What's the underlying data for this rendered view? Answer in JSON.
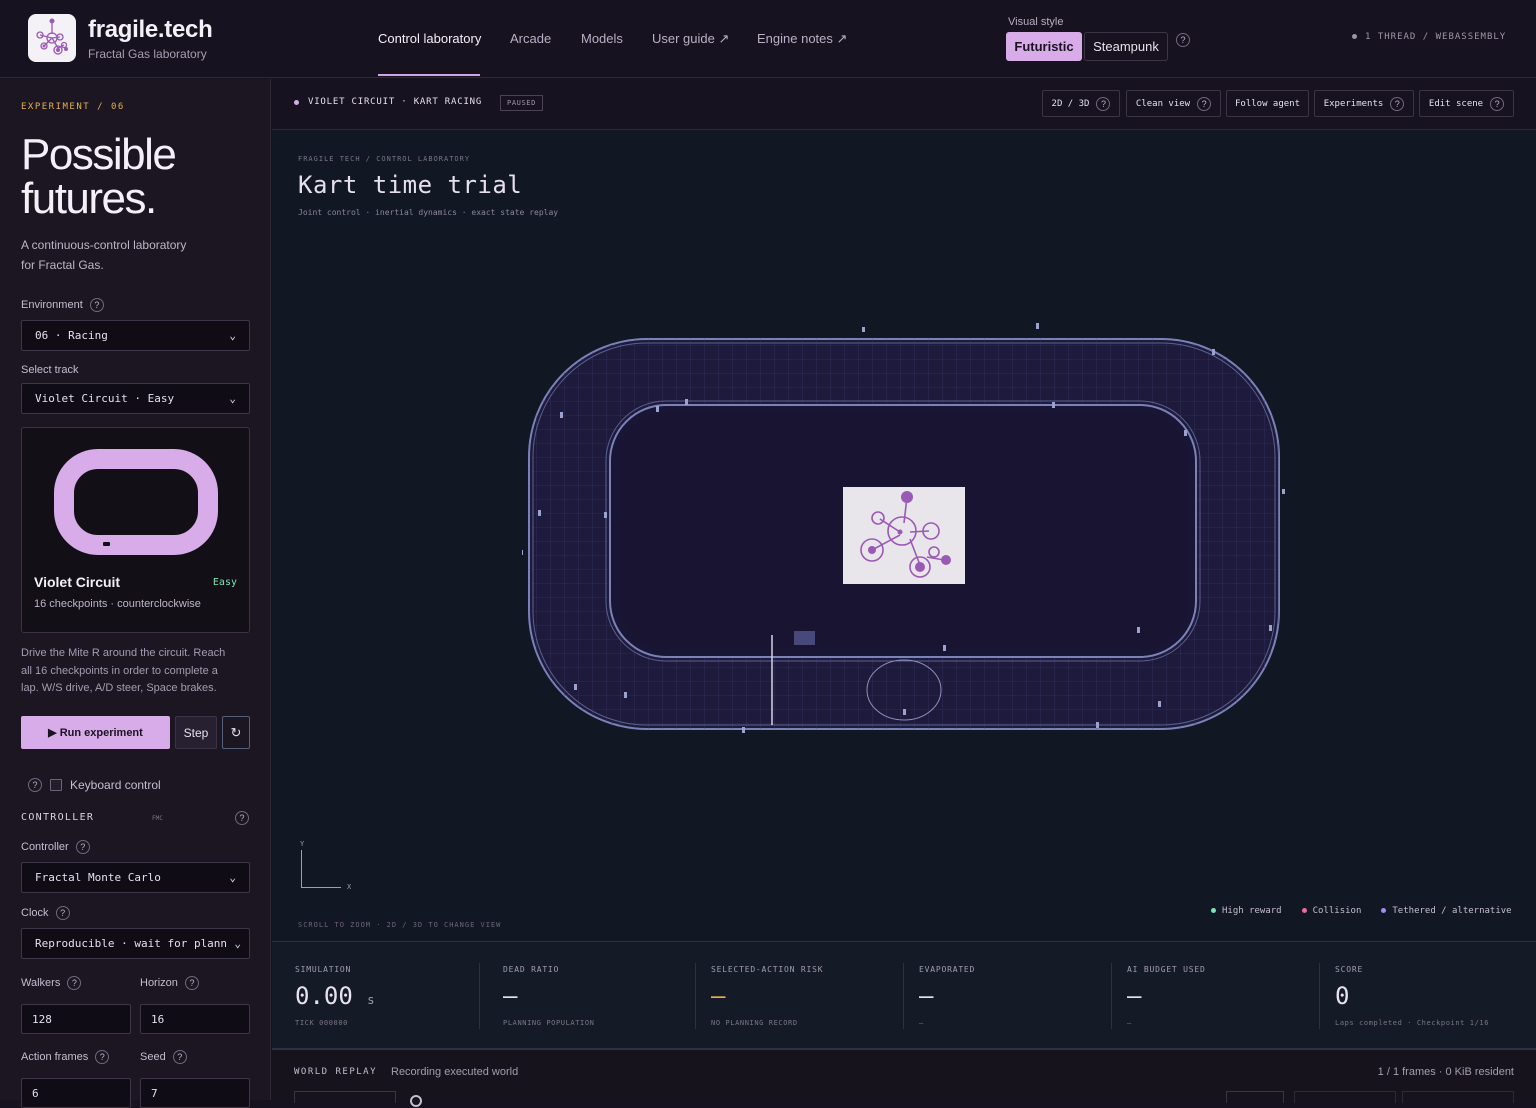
{
  "header": {
    "brand": "fragile.tech",
    "brand_sub": "Fractal Gas laboratory",
    "nav": [
      "Control laboratory",
      "Arcade",
      "Models",
      "User guide ↗",
      "Engine notes ↗"
    ],
    "visual_style_label": "Visual style",
    "visual_style_options": [
      "Futuristic",
      "Steampunk"
    ],
    "visual_style_selected": "Futuristic",
    "thread_status": "1 THREAD / WEBASSEMBLY"
  },
  "sidebar": {
    "experiment": "EXPERIMENT / 06",
    "title_line1": "Possible",
    "title_line2": "futures.",
    "subtitle_line1": "A continuous-control laboratory",
    "subtitle_line2": "for Fractal Gas.",
    "environment_label": "Environment",
    "environment_value": "06 · Racing",
    "track_label": "Select track",
    "track_value": "Violet Circuit · Easy",
    "track_card": {
      "name": "Violet Circuit",
      "difficulty": "Easy",
      "meta": "16 checkpoints · counterclockwise"
    },
    "description": [
      "Drive the Mite R around the circuit. Reach",
      "all 16 checkpoints in order to complete a",
      "lap. W/S drive, A/D steer, Space brakes."
    ],
    "run_button": "▶ Run experiment",
    "step_button": "Step",
    "reset_icon": "↻",
    "keyboard_control": "Keyboard control",
    "controller_section": "CONTROLLER",
    "controller_badge": "FMC",
    "controller_label": "Controller",
    "controller_value": "Fractal Monte Carlo",
    "clock_label": "Clock",
    "clock_value": "Reproducible · wait for plann",
    "walkers_label": "Walkers",
    "walkers_value": "128",
    "horizon_label": "Horizon",
    "horizon_value": "16",
    "action_frames_label": "Action frames",
    "action_frames_value": "6",
    "seed_label": "Seed",
    "seed_value": "7"
  },
  "toolbar": {
    "scene": "VIOLET CIRCUIT · KART RACING",
    "status": "PAUSED",
    "buttons": [
      "2D / 3D",
      "Clean view",
      "Follow agent",
      "Experiments",
      "Edit scene"
    ]
  },
  "viewport": {
    "breadcrumb": "FRAGILE TECH / CONTROL LABORATORY",
    "title": "Kart time trial",
    "subtitle": "Joint control · inertial dynamics · exact state replay",
    "axis_y": "Y",
    "axis_x": "X",
    "hint": "SCROLL TO ZOOM · 2D / 3D TO CHANGE VIEW",
    "legend": [
      {
        "label": "High reward",
        "color": "#7fe0b6"
      },
      {
        "label": "Collision",
        "color": "#f06a9c"
      },
      {
        "label": "Tethered / alternative",
        "color": "#a18cf0"
      }
    ]
  },
  "stats": [
    {
      "label": "SIMULATION",
      "value": "0.00",
      "unit": "s",
      "sub": "TICK 000000"
    },
    {
      "label": "DEAD RATIO",
      "value": "—",
      "unit": "",
      "sub": "PLANNING POPULATION"
    },
    {
      "label": "SELECTED-ACTION RISK",
      "value": "—",
      "unit": "",
      "sub": "NO PLANNING RECORD"
    },
    {
      "label": "EVAPORATED",
      "value": "—",
      "unit": "",
      "sub": "—"
    },
    {
      "label": "AI BUDGET USED",
      "value": "—",
      "unit": "",
      "sub": "—"
    },
    {
      "label": "SCORE",
      "value": "0",
      "unit": "",
      "sub": "Laps completed · Checkpoint 1/16"
    }
  ],
  "replay": {
    "title": "WORLD REPLAY",
    "status": "Recording executed world",
    "frames": "1 / 1 frames · 0 KiB resident"
  },
  "colors": {
    "accent": "#d7ace9",
    "easy": "#7fe0b6",
    "selected_risk": "#e6b04a"
  }
}
